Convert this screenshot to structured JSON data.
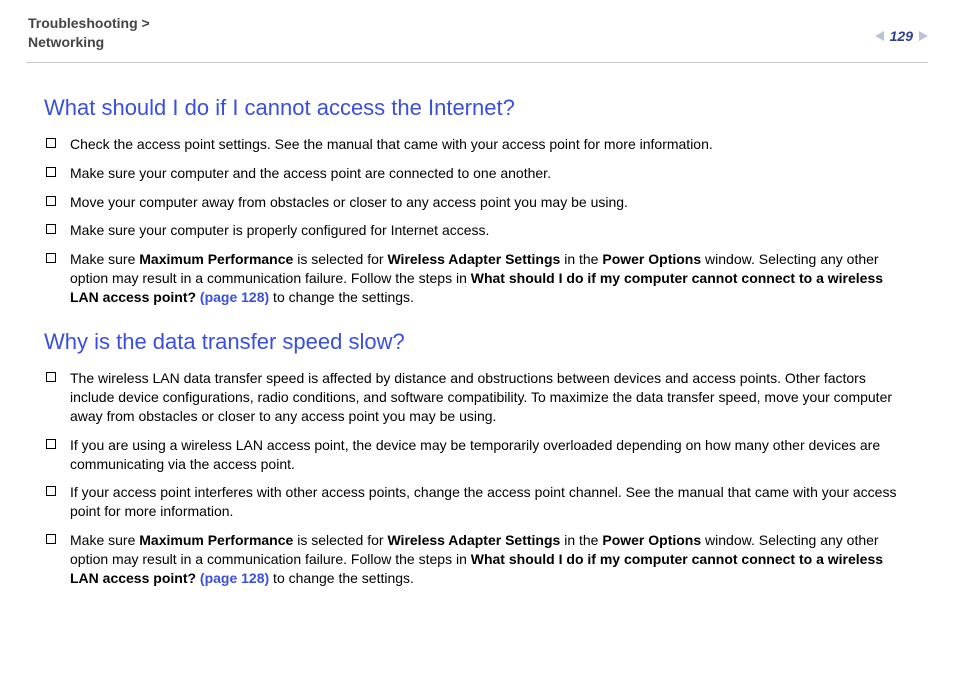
{
  "header": {
    "breadcrumb_line1": "Troubleshooting >",
    "breadcrumb_line2": "Networking",
    "page_number": "129"
  },
  "sections": [
    {
      "heading": "What should I do if I cannot access the Internet?",
      "items": [
        {
          "html": "Check the access point settings. See the manual that came with your access point for more information."
        },
        {
          "html": "Make sure your computer and the access point are connected to one another."
        },
        {
          "html": "Move your computer away from obstacles or closer to any access point you may be using."
        },
        {
          "html": "Make sure your computer is properly configured for Internet access."
        },
        {
          "html": "Make sure <b>Maximum Performance</b> is selected for <b>Wireless Adapter Settings</b> in the <b>Power Options</b> window. Selecting any other option may result in a communication failure. Follow the steps in <b>What should I do if my computer cannot connect to a wireless LAN access point? <span class=\"link\">(page 128)</span></b> to change the settings."
        }
      ]
    },
    {
      "heading": "Why is the data transfer speed slow?",
      "items": [
        {
          "html": "The wireless LAN data transfer speed is affected by distance and obstructions between devices and access points. Other factors include device configurations, radio conditions, and software compatibility. To maximize the data transfer speed, move your computer away from obstacles or closer to any access point you may be using."
        },
        {
          "html": "If you are using a wireless LAN access point, the device may be temporarily overloaded depending on how many other devices are communicating via the access point."
        },
        {
          "html": "If your access point interferes with other access points, change the access point channel. See the manual that came with your access point for more information."
        },
        {
          "html": "Make sure <b>Maximum Performance</b> is selected for <b>Wireless Adapter Settings</b> in the <b>Power Options</b> window. Selecting any other option may result in a communication failure. Follow the steps in <b>What should I do if my computer cannot connect to a wireless LAN access point? <span class=\"link\">(page 128)</span></b> to change the settings."
        }
      ]
    }
  ]
}
